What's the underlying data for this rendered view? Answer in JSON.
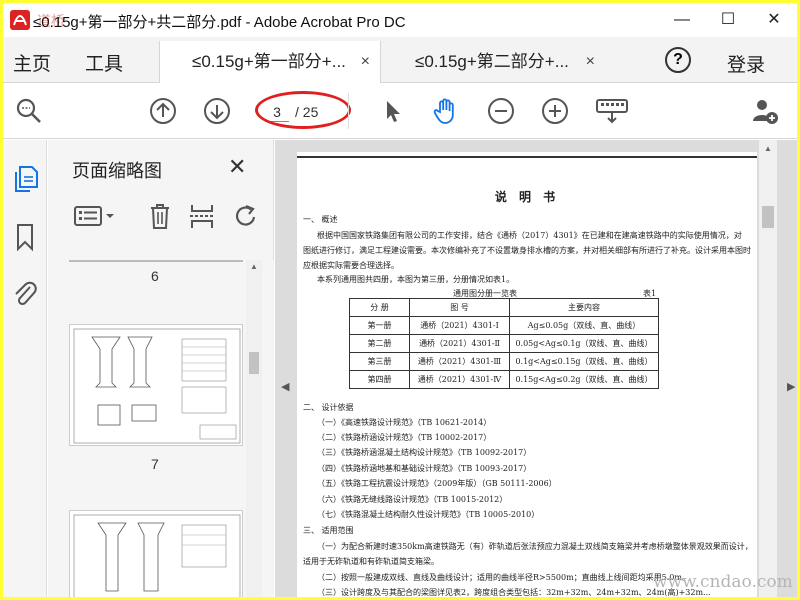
{
  "window": {
    "title": "≤0.15g+第一部分+共二部分.pdf - Adobe Acrobat Pro DC",
    "minimize": "—",
    "maximize": "☐",
    "close": "✕",
    "icon": "acrobat-icon"
  },
  "tabbar": {
    "home": "主页",
    "tools": "工具",
    "tabs": [
      {
        "label": "≤0.15g+第一部分+...",
        "close": "×"
      },
      {
        "label": "≤0.15g+第二部分+...",
        "close": "×"
      }
    ],
    "help": "?",
    "login": "登录"
  },
  "toolbar": {
    "current_page": "3",
    "total_pages": "/ 25",
    "highlight_color": "#e02020",
    "accent_color": "#1473e6"
  },
  "thumbnails": {
    "title": "页面缩略图",
    "close": "✕",
    "page_numbers": [
      "6",
      "7"
    ]
  },
  "document": {
    "title": "说 明 书",
    "sec1": "一、 概述",
    "para1a": "根据中国国家铁路集团有限公司的工作安排，结合《通桥（2017）4301》在已建和在建高速铁路中的实际使用情况，对",
    "para1b": "图纸进行修订，满足工程建设需要。本次修编补充了不设置墩身排水槽的方案，并对相关细部有所进行了补充。设计采用本图时",
    "para1c": "应根据实际需要合理选择。",
    "para2": "本系列通用图共四册，本图为第三册，分册情况如表1。",
    "table_caption": "通用图分册一览表",
    "table_no": "表1",
    "table_headers": [
      "分 册",
      "图 号",
      "主要内容"
    ],
    "table_rows": [
      [
        "第一册",
        "通桥（2021）4301-Ⅰ",
        "Ag≤0.05g（双线、直、曲线）"
      ],
      [
        "第二册",
        "通桥（2021）4301-Ⅱ",
        "0.05g<Ag≤0.1g（双线、直、曲线）"
      ],
      [
        "第三册",
        "通桥（2021）4301-Ⅲ",
        "0.1g<Ag≤0.15g（双线、直、曲线）"
      ],
      [
        "第四册",
        "通桥（2021）4301-Ⅳ",
        "0.15g<Ag≤0.2g（双线、直、曲线）"
      ]
    ],
    "sec2": "二、 设计依据",
    "basis": [
      "（一）《高速铁路设计规范》（TB 10621-2014）",
      "（二）《铁路桥涵设计规范》（TB 10002-2017）",
      "（三）《铁路桥涵混凝土结构设计规范》（TB 10092-2017）",
      "（四）《铁路桥涵地基和基础设计规范》（TB 10093-2017）",
      "（五）《铁路工程抗震设计规范》（2009年版）（GB 50111-2006）",
      "（六）《铁路无缝线路设计规范》（TB 10015-2012）",
      "（七）《铁路混凝土结构耐久性设计规范》（TB 10005-2010）"
    ],
    "sec3": "三、 适用范围",
    "scope1a": "（一）为配合新建时速350km高速铁路无（有）砟轨道后张法预应力混凝土双线简支箱梁并考虑桥墩整体景观效果而设计，",
    "scope1b": "适用于无砟轨道和有砟轨道简支箱梁。",
    "scope2": "（二）按照一般建成双线、直线及曲线设计；适用的曲线半径R>5500m；直曲线上线间距均采用5.0m。",
    "scope3": "（三）设计跨度及与其配合的梁图详见表2，跨度组合类型包括：32m+32m、24m+32m、24m(高)+32m..."
  },
  "watermark": "www.cndao.com",
  "corner_mark": "道桥"
}
